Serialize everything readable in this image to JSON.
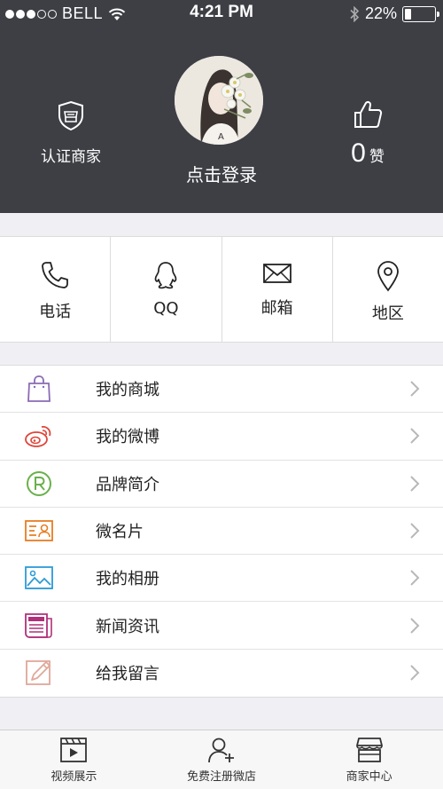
{
  "status_bar": {
    "carrier": "BELL",
    "time": "4:21 PM",
    "battery_text": "22%",
    "battery_level": 0.22
  },
  "profile": {
    "cert_label": "认证商家",
    "login_label": "点击登录",
    "like_count": "0",
    "like_label": "赞"
  },
  "contacts": [
    {
      "label": "电话",
      "icon": "phone-icon"
    },
    {
      "label": "QQ",
      "icon": "qq-icon"
    },
    {
      "label": "邮箱",
      "icon": "mail-icon"
    },
    {
      "label": "地区",
      "icon": "location-icon"
    }
  ],
  "menu": [
    {
      "label": "我的商城",
      "icon": "shopping-bag-icon",
      "color": "#8b6bb5"
    },
    {
      "label": "我的微博",
      "icon": "weibo-icon",
      "color": "#e0443a"
    },
    {
      "label": "品牌简介",
      "icon": "registered-icon",
      "color": "#6ab04c"
    },
    {
      "label": "微名片",
      "icon": "business-card-icon",
      "color": "#e67e22"
    },
    {
      "label": "我的相册",
      "icon": "photo-album-icon",
      "color": "#2e9bd6"
    },
    {
      "label": "新闻资讯",
      "icon": "news-icon",
      "color": "#b0307a"
    },
    {
      "label": "给我留言",
      "icon": "message-edit-icon",
      "color": "#e0a899"
    }
  ],
  "tabbar": [
    {
      "label": "视频展示",
      "icon": "video-icon"
    },
    {
      "label": "免费注册微店",
      "icon": "add-user-icon"
    },
    {
      "label": "商家中心",
      "icon": "store-icon"
    }
  ],
  "colors": {
    "header_bg": "#3d3f45",
    "page_bg": "#efeff4",
    "chevron": "#b8b8b8"
  }
}
